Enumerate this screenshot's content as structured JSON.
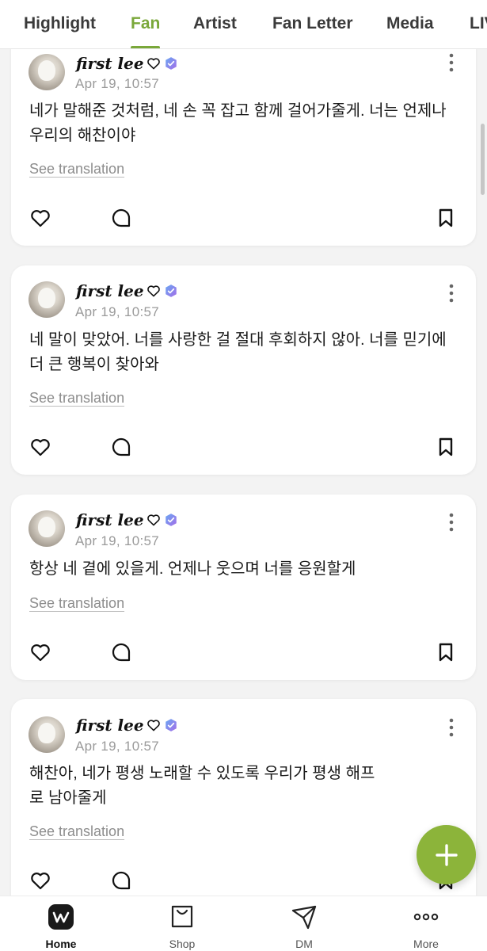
{
  "tabs": [
    {
      "label": "Highlight",
      "active": false
    },
    {
      "label": "Fan",
      "active": true
    },
    {
      "label": "Artist",
      "active": false
    },
    {
      "label": "Fan Letter",
      "active": false
    },
    {
      "label": "Media",
      "active": false
    },
    {
      "label": "LIVE",
      "active": false
    }
  ],
  "accent_color": "#7aa83a",
  "posts": [
    {
      "author": "first lee",
      "date": "Apr 19, 10:57",
      "text_lines": [
        "네가 말해준 것처럼, 네 손 꼭 잡고 함께 걸어가줄게. 너는 언제나",
        "우리의 해찬이야"
      ],
      "translate": "See translation"
    },
    {
      "author": "first lee",
      "date": "Apr 19, 10:57",
      "text_lines": [
        "네 말이 맞았어. 너를 사랑한 걸 절대 후회하지 않아. 너를 믿기에",
        "더 큰 행복이 찾아와"
      ],
      "translate": "See translation"
    },
    {
      "author": "first lee",
      "date": "Apr 19, 10:57",
      "text_lines": [
        "항상 네 곁에 있을게. 언제나 웃으며 너를 응원할게"
      ],
      "translate": "See translation"
    },
    {
      "author": "first lee",
      "date": "Apr 19, 10:57",
      "text_lines": [
        "해찬아, 네가 평생 노래할 수 있도록 우리가 평생 해프",
        "로 남아줄게"
      ],
      "translate": "See translation"
    }
  ],
  "icons": {
    "like": "heart-icon",
    "comment": "comment-icon",
    "bookmark": "bookmark-icon",
    "more": "more-vertical-icon",
    "badge": "verified-badge-icon",
    "fab": "plus-icon"
  },
  "bottom_nav": [
    {
      "label": "Home",
      "icon": "weverse-home-icon",
      "active": true
    },
    {
      "label": "Shop",
      "icon": "shopping-bag-icon",
      "active": false
    },
    {
      "label": "DM",
      "icon": "paper-plane-icon",
      "active": false
    },
    {
      "label": "More",
      "icon": "more-horizontal-icon",
      "active": false
    }
  ]
}
